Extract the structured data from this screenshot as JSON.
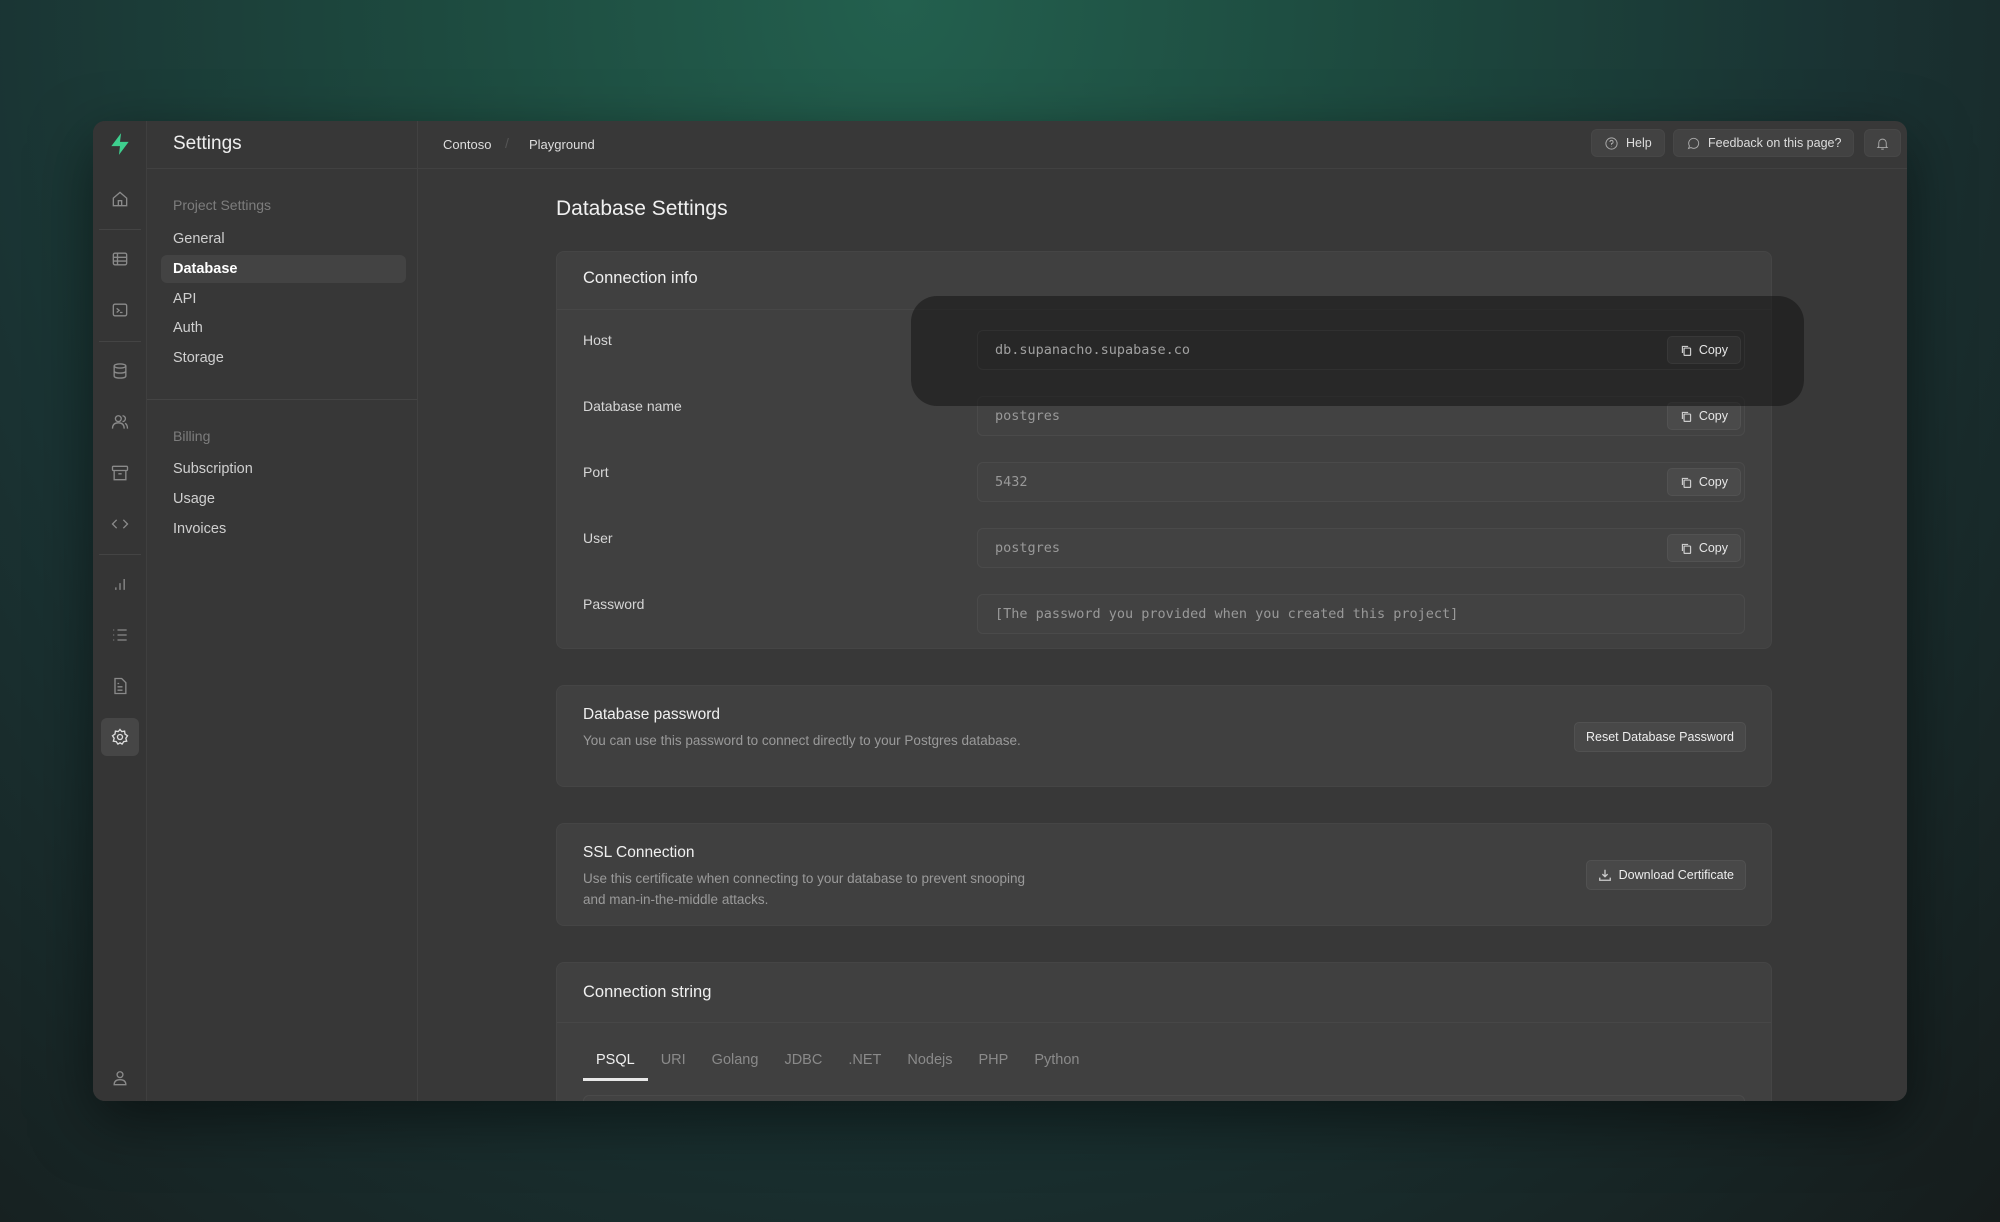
{
  "app": {
    "title": "Settings",
    "brand_color": "#3ecf8e"
  },
  "rail": [
    "home-icon",
    "table-editor-icon",
    "sql-editor-icon",
    "database-icon",
    "users-icon",
    "storage-icon",
    "api-code-icon",
    "reports-icon",
    "logs-icon",
    "docs-icon",
    "settings-icon",
    "profile-icon"
  ],
  "sidebar": {
    "groups": [
      {
        "label": "Project Settings",
        "items": [
          "General",
          "Database",
          "API",
          "Auth",
          "Storage"
        ]
      },
      {
        "label": "Billing",
        "items": [
          "Subscription",
          "Usage",
          "Invoices"
        ]
      }
    ],
    "active": "Database"
  },
  "breadcrumb": [
    "Contoso",
    "Playground"
  ],
  "topbar": {
    "help": "Help",
    "feedback": "Feedback on this page?"
  },
  "page": {
    "title": "Database Settings"
  },
  "connection_info": {
    "title": "Connection info",
    "copy_label": "Copy",
    "rows": [
      {
        "label": "Host",
        "value": "db.supanacho.supabase.co"
      },
      {
        "label": "Database name",
        "value": "postgres"
      },
      {
        "label": "Port",
        "value": "5432"
      },
      {
        "label": "User",
        "value": "postgres"
      },
      {
        "label": "Password",
        "value": "[The password you provided when you created this project]"
      }
    ]
  },
  "db_password": {
    "title": "Database password",
    "desc": "You can use this password to connect directly to your Postgres database.",
    "button": "Reset Database Password"
  },
  "ssl": {
    "title": "SSL Connection",
    "desc": "Use this certificate when connecting to your database to prevent snooping and man-in-the-middle attacks.",
    "button": "Download Certificate"
  },
  "conn_string": {
    "title": "Connection string",
    "tabs": [
      "PSQL",
      "URI",
      "Golang",
      "JDBC",
      ".NET",
      "Nodejs",
      "PHP",
      "Python"
    ],
    "active_tab": "PSQL"
  }
}
